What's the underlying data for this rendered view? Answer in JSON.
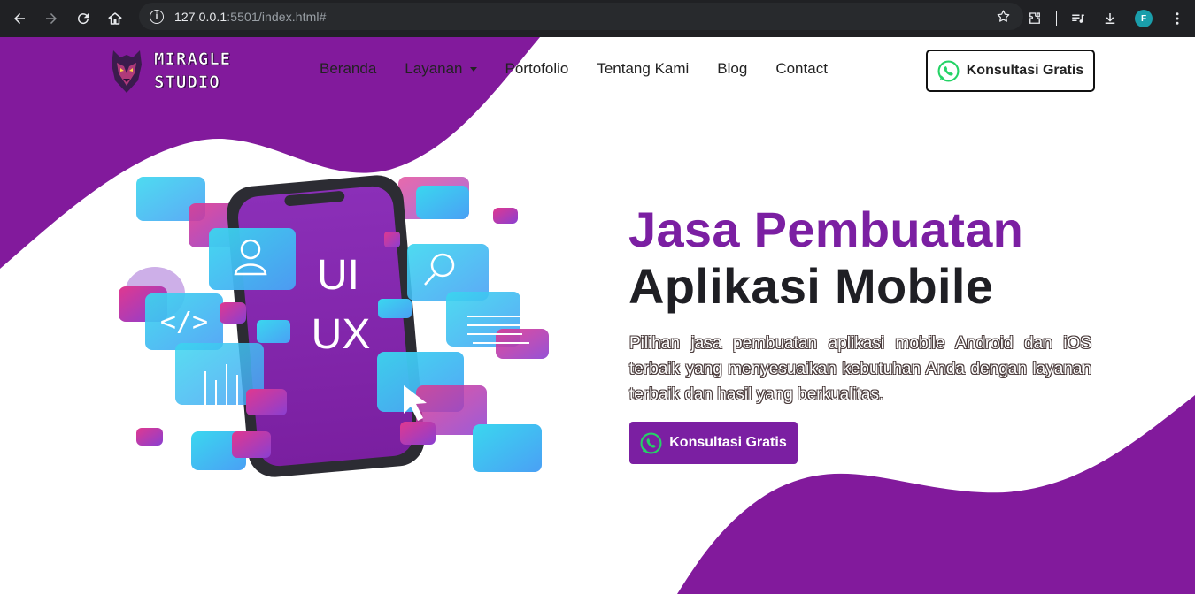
{
  "browser": {
    "url_host": "127.0.0.1",
    "url_rest": ":5501/index.html#",
    "profile_initial": "F",
    "icons": [
      "back-icon",
      "forward-icon",
      "reload-icon",
      "home-icon",
      "site-info-icon",
      "bookmark-star-icon",
      "extensions-icon",
      "media-icon",
      "download-icon",
      "menu-dots-icon"
    ]
  },
  "brand": {
    "line1": "MIRAGLE",
    "line2": "STUDIO"
  },
  "nav": {
    "items": [
      {
        "label": "Beranda"
      },
      {
        "label": "Layanan",
        "dropdown": true
      },
      {
        "label": "Portofolio"
      },
      {
        "label": "Tentang Kami"
      },
      {
        "label": "Blog"
      },
      {
        "label": "Contact"
      }
    ],
    "cta_label": "Konsultasi Gratis"
  },
  "hero": {
    "title_line1": "Jasa Pembuatan",
    "title_line2": "Aplikasi Mobile",
    "description": "Pilihan jasa pembuatan aplikasi mobile Android dan iOS terbaik yang menyesuaikan kebutuhan Anda dengan layanan terbaik dan hasil yang berkualitas.",
    "cta_label": "Konsultasi Gratis",
    "phone_text_1": "UI",
    "phone_text_2": "UX"
  },
  "colors": {
    "brand_purple": "#7b1fa2",
    "blob_purple": "#821a9c",
    "dark_text": "#1f1f24",
    "whatsapp_green": "#25d366"
  }
}
